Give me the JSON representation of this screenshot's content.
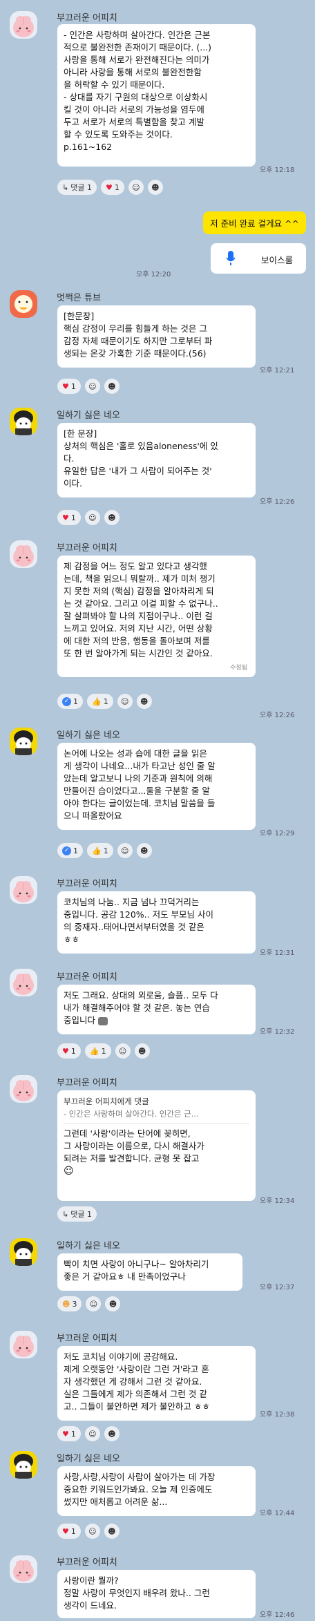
{
  "senders": {
    "peach": "부끄러운 어피치",
    "tube": "멋쩍은 튜브",
    "neo": "일하기 싫은 네오"
  },
  "colors": {
    "background": "#b2c7da",
    "my_bubble": "#fee500",
    "heart": "#e6213d",
    "check_blue": "#3b82f6"
  },
  "messages": [
    {
      "id": "m1",
      "sender": "부끄러운 어피치",
      "lines": [
        "- 인간은 사랑하며 살아간다. 인간은 근본",
        "적으로 불완전한 존재이기 때문이다. (...)",
        "사랑을 통해 서로가 완전해진다는 의미가",
        " 아니라 사랑을 통해 서로의 불완전한함",
        "을 허락할 수 있기 때문이다.",
        "- 상대를 자기 구원의 대상으로 이상화시",
        "킬 것이 아니라 서로의 가능성을 염두에",
        "두고 서로가 서로의 특별함을 찾고 계발",
        "할 수 있도록 도와주는 것이다.",
        "p.161~162"
      ],
      "time": "오후 12:18",
      "reactions": [
        {
          "icon": "reply-icon",
          "label": "댓글 1"
        },
        {
          "icon": "heart-icon",
          "count": "1"
        },
        {
          "icon": "add-reaction-icon"
        },
        {
          "icon": "person-icon"
        }
      ]
    },
    {
      "id": "mine1",
      "text": "저 준비 완료 걸게요 ^^"
    },
    {
      "id": "voice",
      "label": "보이스룸",
      "time": "오후 12:20"
    },
    {
      "id": "m2",
      "sender": "멋쩍은 튜브",
      "lines": [
        "[한문장]",
        "핵심 감정이 우리를 힘들게 하는 것은 그",
        "감정 자체 때문이기도 하지만 그로부터 파",
        "생되는 온갖 가혹한 기준 때문이다.(56)"
      ],
      "time": "오후 12:21",
      "reactions": [
        {
          "icon": "heart-icon",
          "count": "1"
        },
        {
          "icon": "add-reaction-icon"
        },
        {
          "icon": "person-icon"
        }
      ]
    },
    {
      "id": "m3",
      "sender": "일하기 싫은 네오",
      "lines": [
        "[한 문장]",
        "상처의 핵심은 '홀로 있음aloneness'에 있",
        "다.",
        "유일한 답은 '내가 그 사람이 되어주는 것'",
        "이다."
      ],
      "time": "오후 12:26",
      "reactions": [
        {
          "icon": "heart-icon",
          "count": "1"
        },
        {
          "icon": "add-reaction-icon"
        },
        {
          "icon": "person-icon"
        }
      ]
    },
    {
      "id": "m4",
      "sender": "부끄러운 어피치",
      "lines": [
        "제 감정을 어느 정도 알고 있다고 생각했",
        "는데, 책을 읽으니 뭐랄까.. 제가 미처 챙기",
        "지 못한 저의 (핵심) 감정을 알아차리게 되",
        "는 것 같아요. 그리고 이걸 피할 수 없구나..",
        "잘 살펴봐야 할 나의 지점이구나..  이런 걸",
        " 느끼고 있어요. 저의 지난 시간, 어떤 상황",
        "에 대한 저의 반응, 행동을 돌아보며 저를",
        "또 한 번 알아가게 되는 시간인 것 같아요."
      ],
      "edited": "수정됨",
      "time": "오후 12:26",
      "reactions": [
        {
          "icon": "check-icon",
          "count": "1"
        },
        {
          "icon": "thumbs-up-icon",
          "count": "1"
        },
        {
          "icon": "add-reaction-icon"
        },
        {
          "icon": "person-icon"
        }
      ]
    },
    {
      "id": "m5",
      "sender": "일하기 싫은 네오",
      "lines": [
        "논어에 나오는 성과 습에 대한 글을 읽은",
        "게 생각이 나네요...내가 타고난 성인 줄 알",
        "았는데 알고보니 나의 기준과 원칙에 의해",
        " 만들어진 습이었다고...둘을 구분할 줄 알",
        "아야 한다는 글이었는데. 코치님 말씀을 들",
        "으니 떠올랐어요"
      ],
      "time": "오후 12:29",
      "reactions": [
        {
          "icon": "check-icon",
          "count": "1"
        },
        {
          "icon": "thumbs-up-icon",
          "count": "1"
        },
        {
          "icon": "add-reaction-icon"
        },
        {
          "icon": "person-icon"
        }
      ]
    },
    {
      "id": "m6",
      "sender": "부끄러운 어피치",
      "lines": [
        "코치님의 나눔.. 지금 넘나 끄덕거리는",
        "중입니다. 공감 120%.. 저도 부모님 사이",
        "의 중재자..태어나면서부터였을 것 같은",
        "ㅎㅎ"
      ],
      "time": "오후 12:31"
    },
    {
      "id": "m7",
      "sender": "부끄러운 어피치",
      "lines": [
        "저도 그래요. 상대의 외로움, 슬픔.. 모두 다",
        " 내가 해결해주어야 할 것 같은. 놓는 연습",
        "중입니다"
      ],
      "time": "오후 12:32",
      "reactions": [
        {
          "icon": "heart-icon",
          "count": "1"
        },
        {
          "icon": "thumbs-up-icon",
          "count": "1"
        },
        {
          "icon": "add-reaction-icon"
        },
        {
          "icon": "person-icon"
        }
      ]
    },
    {
      "id": "m8",
      "sender": "부끄러운 어피치",
      "reply_to": "부끄러운 어피치에게 댓글",
      "quote": "- 인간은 사랑하며 살아간다. 인간은 근...",
      "lines": [
        "그런데 '사랑'이라는 단어에 꽂히면,",
        " 그 사랑이라는 이름으로, 다시 해결사가",
        "되려는 저를 발견합니다. 균형 못 잡고"
      ],
      "time": "오후 12:34",
      "reactions": [
        {
          "icon": "reply-icon",
          "label": "댓글 1"
        }
      ]
    },
    {
      "id": "m9",
      "sender": "일하기 싫은 네오",
      "lines": [
        "빡이 치면 사랑이 아니구나~ 알아차리기",
        "좋은 거 같아요ㅎ 내 만족이었구나"
      ],
      "time": "오후 12:37",
      "reactions": [
        {
          "icon": "laugh-icon",
          "count": "3"
        },
        {
          "icon": "add-reaction-icon"
        },
        {
          "icon": "person-icon"
        }
      ]
    },
    {
      "id": "m10",
      "sender": "부끄러운 어피치",
      "lines": [
        "저도 코치님 이야기에 공감해요.",
        "제게 오랫동안 '사랑이란 그런 거'라고 혼",
        "자 생각했던 게 강해서 그런 것 같아요.",
        "실은 그들에게 제가 의존해서 그런 것 같",
        "고.. 그들이 불안하면 제가 불안하고 ㅎㅎ"
      ],
      "time": "오후 12:38",
      "reactions": [
        {
          "icon": "heart-icon",
          "count": "1"
        },
        {
          "icon": "add-reaction-icon"
        },
        {
          "icon": "person-icon"
        }
      ]
    },
    {
      "id": "m11",
      "sender": "일하기 싫은 네오",
      "lines": [
        "사랑,사랑,사랑이 사람이 살아가는 데 가장",
        "중요한 키워드인가봐요. 오늘 제 인증에도",
        "썼지만 애처롭고 어려운 삶..."
      ],
      "time": "오후 12:44",
      "reactions": [
        {
          "icon": "heart-icon",
          "count": "1"
        },
        {
          "icon": "add-reaction-icon"
        },
        {
          "icon": "person-icon"
        }
      ]
    },
    {
      "id": "m12",
      "sender": "부끄러운 어피치",
      "lines": [
        "사랑이란 뭘까?",
        "정말 사랑이 무엇인지 배우려 왔나.. 그런",
        "생각이 드네요."
      ],
      "time": "오후 12:46"
    }
  ]
}
